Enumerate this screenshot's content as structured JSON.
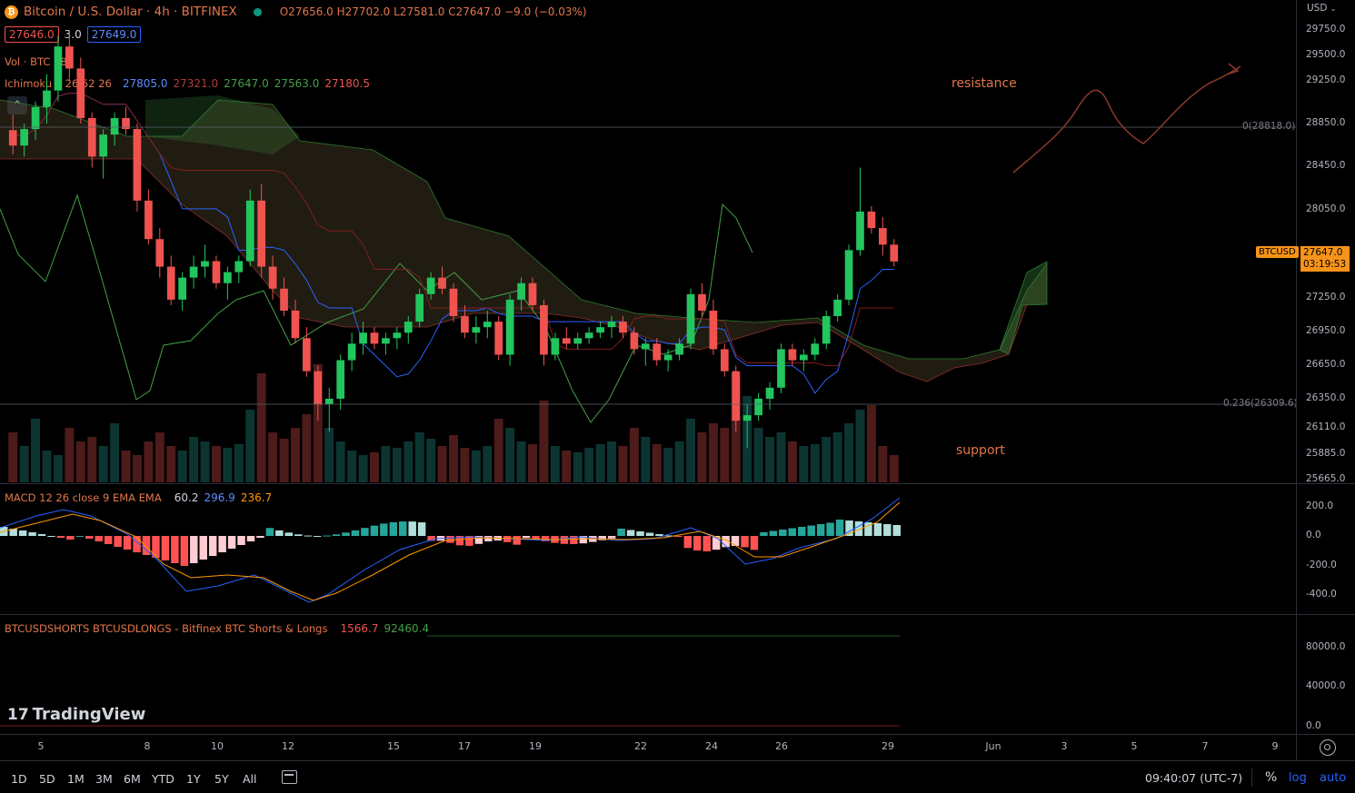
{
  "header": {
    "symbol_title": "Bitcoin / U.S. Dollar · 4h · BITFINEX",
    "open": "O27656.0",
    "high": "H27702.0",
    "low": "L27581.0",
    "close": "C27647.0",
    "change": "−9.0 (−0.03%)",
    "bid": "27646.0",
    "spread": "3.0",
    "ask": "27649.0",
    "currency": "USD"
  },
  "legends": {
    "vol": "Vol · BTC 18",
    "ichimoku_name": "Ichimoku 9 26 52 26",
    "ichimoku_values": [
      "27805.0",
      "27321.0",
      "27647.0",
      "27563.0",
      "27180.5"
    ],
    "macd_name": "MACD 12 26 close 9 EMA EMA",
    "macd_values": [
      "60.2",
      "296.9",
      "236.7"
    ],
    "shorts_name": "BTCUSDSHORTS BTCUSDLONGS - Bitfinex BTC Shorts & Longs",
    "shorts_values": [
      "1566.7",
      "92460.4"
    ]
  },
  "annotations": {
    "resistance": "resistance",
    "support": "support",
    "fib0": "0(28818.0)",
    "fib236": "0.236(26309.6)"
  },
  "price_scale": {
    "ticks": [
      "29750.0",
      "29500.0",
      "29250.0",
      "28850.0",
      "28450.0",
      "28050.0",
      "27250.0",
      "26950.0",
      "26650.0",
      "26350.0",
      "26110.0",
      "25885.0",
      "25665.0"
    ],
    "current_label": "BTCUSD",
    "current_price": "27647.0",
    "countdown": "03:19:53"
  },
  "macd_scale": [
    "200.0",
    "0.0",
    "-200.0",
    "-400.0"
  ],
  "shorts_scale": [
    "80000.0",
    "40000.0",
    "0.0"
  ],
  "time_axis": [
    "5",
    "8",
    "10",
    "12",
    "15",
    "17",
    "19",
    "22",
    "24",
    "26",
    "29",
    "Jun",
    "3",
    "5",
    "7",
    "9"
  ],
  "logo": "TradingView",
  "bottom": {
    "ranges": [
      "1D",
      "5D",
      "1M",
      "3M",
      "6M",
      "YTD",
      "1Y",
      "5Y",
      "All"
    ],
    "clock": "09:40:07 (UTC-7)",
    "percent": "%",
    "log": "log",
    "auto": "auto"
  },
  "colors": {
    "up": "#26a69a",
    "up_candle": "#22c55e",
    "down": "#ef5350",
    "blue": "#2962ff",
    "orange": "#ff9800",
    "annotation": "#e3764a"
  },
  "chart_data": {
    "type": "candlestick",
    "candles": [
      [
        28840,
        28980,
        28620,
        28700
      ],
      [
        28700,
        28900,
        28600,
        28850
      ],
      [
        28850,
        29100,
        28750,
        29050
      ],
      [
        29050,
        29350,
        28900,
        29200
      ],
      [
        29200,
        29700,
        29100,
        29600
      ],
      [
        29600,
        29750,
        29300,
        29400
      ],
      [
        29400,
        29500,
        28900,
        28950
      ],
      [
        28950,
        29000,
        28500,
        28600
      ],
      [
        28600,
        28850,
        28400,
        28800
      ],
      [
        28800,
        29000,
        28700,
        28950
      ],
      [
        28950,
        29050,
        28800,
        28850
      ],
      [
        28850,
        28900,
        28100,
        28200
      ],
      [
        28200,
        28300,
        27800,
        27850
      ],
      [
        27850,
        27950,
        27500,
        27600
      ],
      [
        27600,
        27700,
        27250,
        27300
      ],
      [
        27300,
        27550,
        27200,
        27500
      ],
      [
        27500,
        27700,
        27400,
        27600
      ],
      [
        27600,
        27800,
        27500,
        27650
      ],
      [
        27650,
        27700,
        27400,
        27450
      ],
      [
        27450,
        27600,
        27300,
        27550
      ],
      [
        27550,
        27700,
        27450,
        27650
      ],
      [
        27650,
        28300,
        27600,
        28200
      ],
      [
        28200,
        28350,
        27500,
        27600
      ],
      [
        27600,
        27700,
        27300,
        27400
      ],
      [
        27400,
        27500,
        27150,
        27200
      ],
      [
        27200,
        27300,
        26900,
        26950
      ],
      [
        26950,
        27050,
        26600,
        26650
      ],
      [
        26650,
        26700,
        26200,
        26350
      ],
      [
        26350,
        26500,
        26100,
        26400
      ],
      [
        26400,
        26800,
        26300,
        26750
      ],
      [
        26750,
        27000,
        26650,
        26900
      ],
      [
        26900,
        27100,
        26800,
        27000
      ],
      [
        27000,
        27050,
        26850,
        26900
      ],
      [
        26900,
        27000,
        26800,
        26950
      ],
      [
        26950,
        27050,
        26850,
        27000
      ],
      [
        27000,
        27150,
        26900,
        27100
      ],
      [
        27100,
        27400,
        27050,
        27350
      ],
      [
        27350,
        27550,
        27300,
        27500
      ],
      [
        27500,
        27600,
        27350,
        27400
      ],
      [
        27400,
        27450,
        27100,
        27150
      ],
      [
        27150,
        27250,
        26950,
        27000
      ],
      [
        27000,
        27150,
        26900,
        27050
      ],
      [
        27050,
        27200,
        26950,
        27100
      ],
      [
        27100,
        27150,
        26750,
        26800
      ],
      [
        26800,
        27350,
        26700,
        27300
      ],
      [
        27300,
        27500,
        27200,
        27450
      ],
      [
        27450,
        27500,
        27200,
        27250
      ],
      [
        27250,
        27300,
        26700,
        26800
      ],
      [
        26800,
        27000,
        26750,
        26950
      ],
      [
        26950,
        27050,
        26850,
        26900
      ],
      [
        26900,
        27000,
        26850,
        26950
      ],
      [
        26950,
        27050,
        26900,
        27000
      ],
      [
        27000,
        27100,
        26950,
        27050
      ],
      [
        27050,
        27150,
        26950,
        27100
      ],
      [
        27100,
        27150,
        26950,
        27000
      ],
      [
        27000,
        27050,
        26800,
        26850
      ],
      [
        26850,
        26950,
        26700,
        26900
      ],
      [
        26900,
        26950,
        26700,
        26750
      ],
      [
        26750,
        26850,
        26650,
        26800
      ],
      [
        26800,
        26950,
        26750,
        26900
      ],
      [
        26900,
        27400,
        26850,
        27350
      ],
      [
        27350,
        27450,
        27150,
        27200
      ],
      [
        27200,
        27300,
        26800,
        26850
      ],
      [
        26850,
        26900,
        26600,
        26650
      ],
      [
        26650,
        26700,
        26100,
        26200
      ],
      [
        26200,
        26350,
        25950,
        26250
      ],
      [
        26250,
        26450,
        26200,
        26400
      ],
      [
        26400,
        26550,
        26300,
        26500
      ],
      [
        26500,
        26900,
        26450,
        26850
      ],
      [
        26850,
        26900,
        26700,
        26750
      ],
      [
        26750,
        26850,
        26650,
        26800
      ],
      [
        26800,
        26950,
        26750,
        26900
      ],
      [
        26900,
        27200,
        26850,
        27150
      ],
      [
        27150,
        27350,
        27100,
        27300
      ],
      [
        27300,
        27800,
        27250,
        27750
      ],
      [
        27750,
        28500,
        27700,
        28100
      ],
      [
        28100,
        28150,
        27900,
        27950
      ],
      [
        27950,
        28050,
        27700,
        27800
      ],
      [
        27800,
        27850,
        27600,
        27647
      ]
    ],
    "yrange": [
      25600,
      29900
    ]
  }
}
